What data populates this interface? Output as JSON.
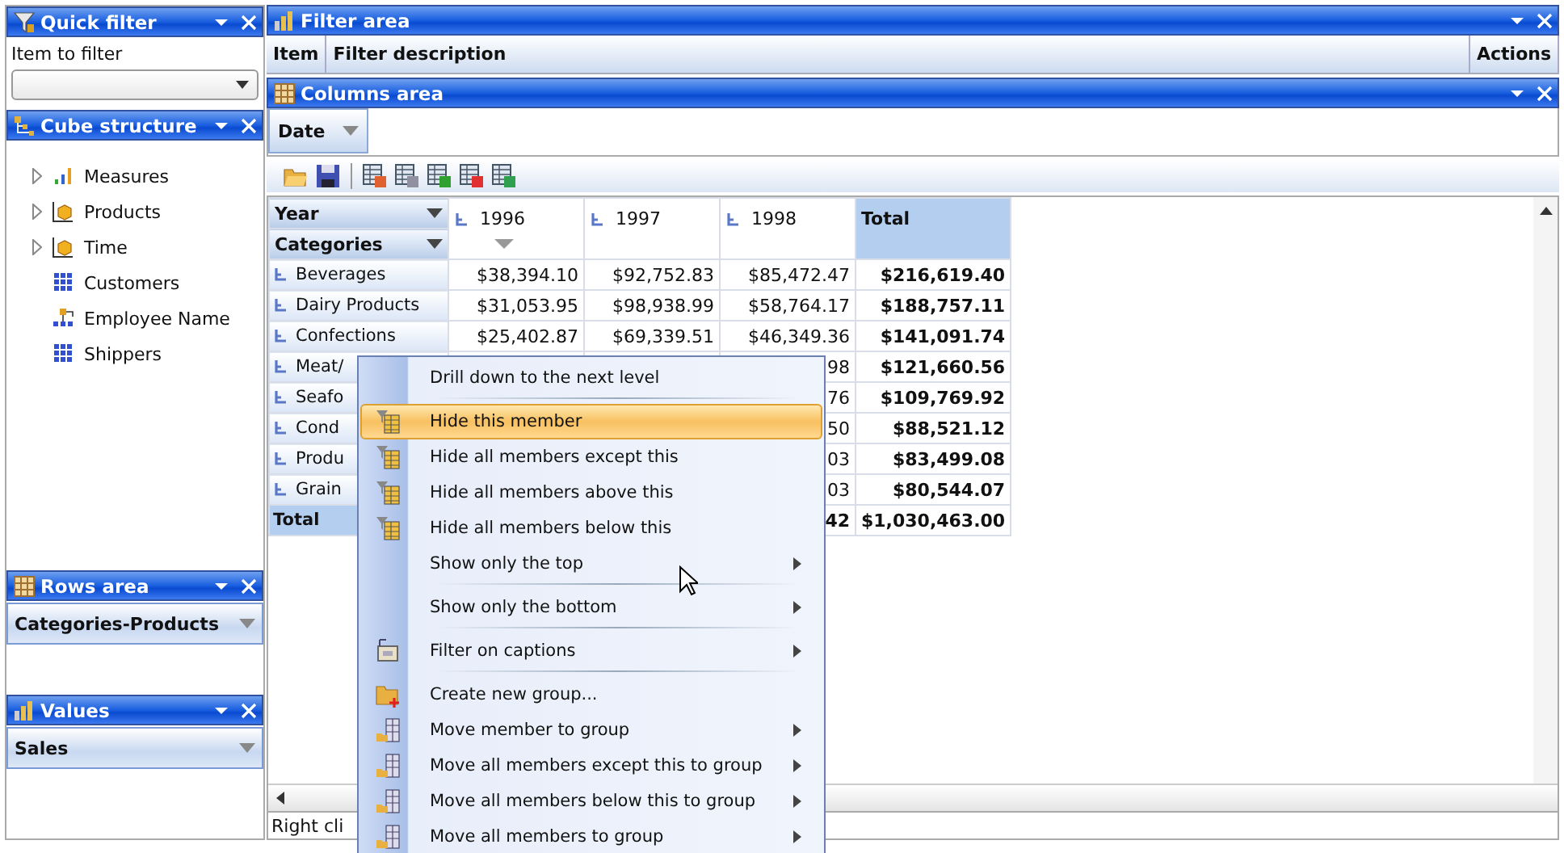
{
  "quick_filter": {
    "title": "Quick filter",
    "label": "Item to filter"
  },
  "cube_structure": {
    "title": "Cube structure",
    "items": [
      {
        "label": "Measures",
        "kind": "measures"
      },
      {
        "label": "Products",
        "kind": "dimension"
      },
      {
        "label": "Time",
        "kind": "dimension"
      },
      {
        "label": "Customers",
        "kind": "hierarchy"
      },
      {
        "label": "Employee Name",
        "kind": "parent_child"
      },
      {
        "label": "Shippers",
        "kind": "hierarchy"
      }
    ]
  },
  "rows_area": {
    "title": "Rows area",
    "fields": [
      "Categories-Products"
    ]
  },
  "values_area": {
    "title": "Values",
    "fields": [
      "Sales"
    ]
  },
  "filter_area": {
    "title": "Filter area",
    "columns": [
      "Item",
      "Filter description",
      "Actions"
    ]
  },
  "columns_area": {
    "title": "Columns area",
    "fields": [
      "Date"
    ]
  },
  "grid": {
    "row_fields": [
      "Year",
      "Categories"
    ],
    "columns": [
      "1996",
      "1997",
      "1998",
      "Total"
    ],
    "rows": [
      {
        "label": "Beverages",
        "values": [
          "$38,394.10",
          "$92,752.83",
          "$85,472.47",
          "$216,619.40"
        ]
      },
      {
        "label": "Dairy Products",
        "values": [
          "$31,053.95",
          "$98,938.99",
          "$58,764.17",
          "$188,757.11"
        ]
      },
      {
        "label": "Confections",
        "values": [
          "$25,402.87",
          "$69,339.51",
          "$46,349.36",
          "$141,091.74"
        ]
      },
      {
        "label": "Meat/",
        "values": [
          "98",
          "$121,660.56"
        ]
      },
      {
        "label": "Seafo",
        "values": [
          "76",
          "$109,769.92"
        ]
      },
      {
        "label": "Cond",
        "values": [
          "50",
          "$88,521.12"
        ]
      },
      {
        "label": "Produ",
        "values": [
          "03",
          "$83,499.08"
        ]
      },
      {
        "label": "Grain",
        "values": [
          "03",
          "$80,544.07"
        ]
      }
    ],
    "total": {
      "label": "Total",
      "values": [
        "42",
        "$1,030,463.00"
      ]
    }
  },
  "status_bar": "Right cli",
  "context_menu": [
    {
      "label": "Drill down to the next level",
      "kind": "drill",
      "submenu": false,
      "selected": false,
      "separator_after": true
    },
    {
      "label": "Hide this member",
      "kind": "hide",
      "submenu": false,
      "selected": true,
      "separator_after": false
    },
    {
      "label": "Hide all members except this",
      "kind": "hide",
      "submenu": false,
      "selected": false,
      "separator_after": false
    },
    {
      "label": "Hide all members above this",
      "kind": "hide",
      "submenu": false,
      "selected": false,
      "separator_after": false
    },
    {
      "label": "Hide all members below this",
      "kind": "hide",
      "submenu": false,
      "selected": false,
      "separator_after": false
    },
    {
      "label": "Show only the top",
      "kind": "show",
      "submenu": true,
      "selected": false,
      "separator_after": true
    },
    {
      "label": "Show only the bottom",
      "kind": "show",
      "submenu": true,
      "selected": false,
      "separator_after": true
    },
    {
      "label": "Filter on captions",
      "kind": "filter",
      "submenu": true,
      "selected": false,
      "separator_after": true
    },
    {
      "label": "Create new group...",
      "kind": "create",
      "submenu": false,
      "selected": false,
      "separator_after": false
    },
    {
      "label": "Move member to group",
      "kind": "move",
      "submenu": true,
      "selected": false,
      "separator_after": false
    },
    {
      "label": "Move all members except this to group",
      "kind": "move",
      "submenu": true,
      "selected": false,
      "separator_after": false
    },
    {
      "label": "Move all members below this to group",
      "kind": "move",
      "submenu": true,
      "selected": false,
      "separator_after": false
    },
    {
      "label": "Move all members to group",
      "kind": "move",
      "submenu": true,
      "selected": false,
      "separator_after": false
    }
  ]
}
